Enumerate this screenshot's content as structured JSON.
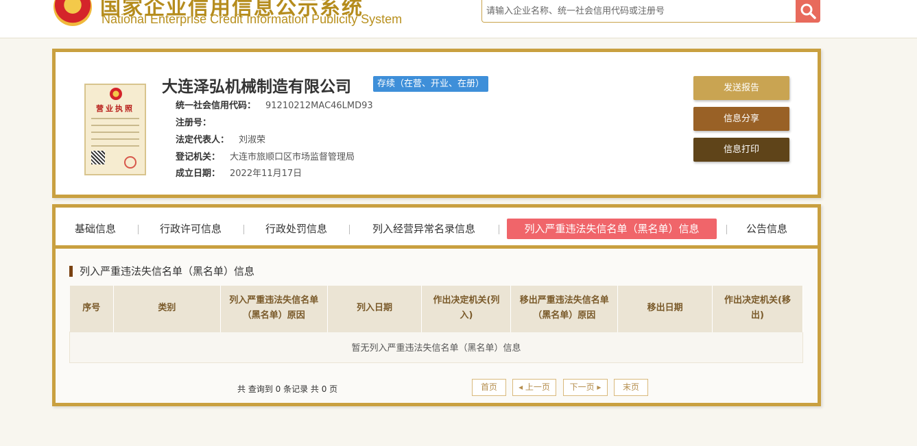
{
  "header": {
    "title_cn": "国家企业信用信息公示系统",
    "title_en": "National Enterprise Credit Information Publicity System",
    "search_placeholder": "请输入企业名称、统一社会信用代码或注册号"
  },
  "company": {
    "name": "大连泽弘机械制造有限公司",
    "status": "存续（在营、开业、在册）",
    "license_title": "营业执照",
    "fields": [
      {
        "label": "统一社会信用代码：",
        "value": "91210212MAC46LMD93"
      },
      {
        "label": "注册号：",
        "value": ""
      },
      {
        "label": "法定代表人：",
        "value": "刘淑荣"
      },
      {
        "label": "登记机关：",
        "value": "大连市旅顺口区市场监督管理局"
      },
      {
        "label": "成立日期：",
        "value": "2022年11月17日"
      }
    ]
  },
  "actions": {
    "send_report": "发送报告",
    "share": "信息分享",
    "print": "信息打印"
  },
  "tabs": [
    {
      "label": "基础信息"
    },
    {
      "label": "行政许可信息"
    },
    {
      "label": "行政处罚信息"
    },
    {
      "label": "列入经营异常名录信息"
    },
    {
      "label": "列入严重违法失信名单（黑名单）信息"
    },
    {
      "label": "公告信息"
    }
  ],
  "section": {
    "title": "列入严重违法失信名单（黑名单）信息",
    "columns": [
      "序号",
      "类别",
      "列入严重违法失信名单（黑名单）原因",
      "列入日期",
      "作出决定机关(列入)",
      "移出严重违法失信名单（黑名单）原因",
      "移出日期",
      "作出决定机关(移出)"
    ],
    "empty_text": "暂无列入严重违法失信名单（黑名单）信息"
  },
  "pager": {
    "summary": "共 查询到 0 条记录 共 0 页",
    "first": "首页",
    "prev": "◂ 上一页",
    "next": "下一页 ▸",
    "last": "末页"
  },
  "colors": {
    "accent_gold": "#c9a040",
    "active_tab": "#f0656a",
    "status_badge": "#3e8fd9"
  }
}
